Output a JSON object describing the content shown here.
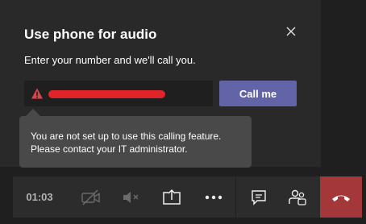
{
  "dialog": {
    "title": "Use phone for audio",
    "subtitle": "Enter your number and we'll call you.",
    "phone_input": {
      "value": "",
      "placeholder": ""
    },
    "call_button_label": "Call me",
    "tooltip": {
      "line1": "You are not set up to use this calling feature.",
      "line2": "Please contact your IT administrator."
    }
  },
  "call_bar": {
    "timer": "01:03",
    "buttons": [
      {
        "name": "camera-off-button",
        "icon": "camera-off-icon"
      },
      {
        "name": "speaker-mute-button",
        "icon": "speaker-muted-icon"
      },
      {
        "name": "share-button",
        "icon": "share-screen-icon"
      },
      {
        "name": "more-actions-button",
        "icon": "more-icon"
      },
      {
        "name": "chat-button",
        "icon": "chat-icon"
      },
      {
        "name": "participants-button",
        "icon": "participants-icon"
      },
      {
        "name": "hang-up-button",
        "icon": "hang-up-icon"
      }
    ]
  },
  "colors": {
    "accent": "#6264a7",
    "hangup": "#a4373a",
    "warning": "#e0424b",
    "redaction": "#e1242a",
    "dialog_bg": "#292929",
    "tooltip_bg": "#494949"
  }
}
